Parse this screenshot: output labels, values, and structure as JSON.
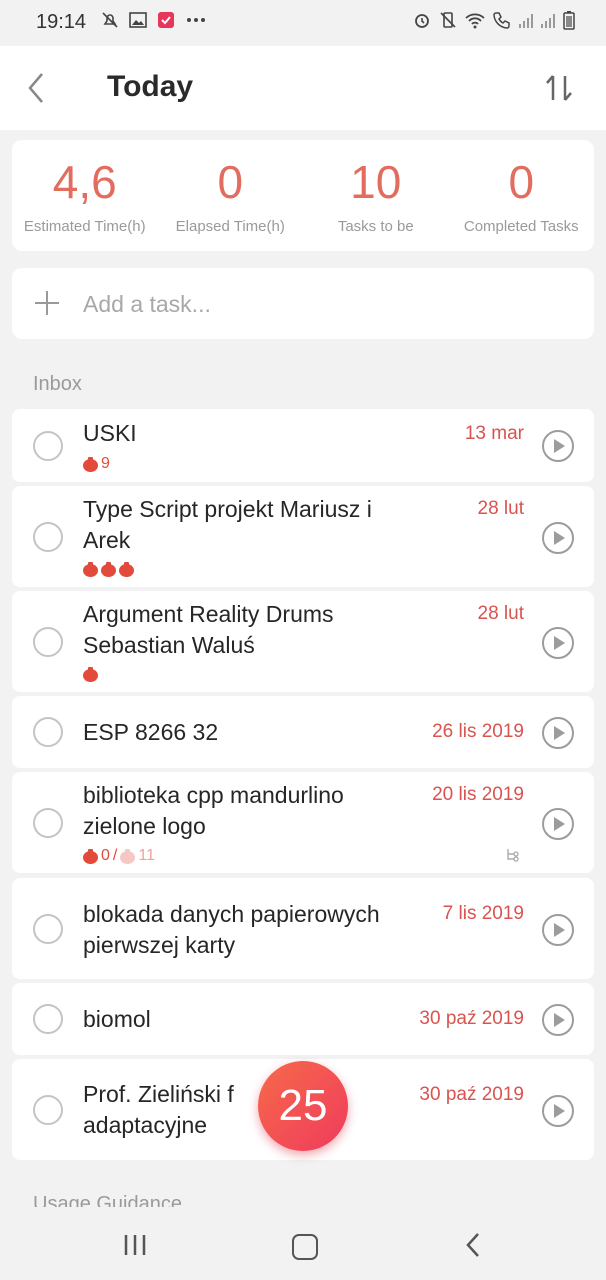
{
  "status_bar": {
    "time": "19:14",
    "left_icons": [
      "mute-notification-icon",
      "gallery-icon",
      "app-notification-icon",
      "more-dots-icon"
    ],
    "right_icons": [
      "alarm-icon",
      "vibrate-off-icon",
      "wifi-icon",
      "wifi-call-icon",
      "signal-icon",
      "signal-icon",
      "battery-icon"
    ]
  },
  "header": {
    "title": "Today",
    "back_icon": "back-chevron-icon",
    "sort_icon": "sort-icon"
  },
  "stats": [
    {
      "value": "4,6",
      "label": "Estimated Time(h)"
    },
    {
      "value": "0",
      "label": "Elapsed Time(h)"
    },
    {
      "value": "10",
      "label": "Tasks to be Completed"
    },
    {
      "value": "0",
      "label": "Completed Tasks"
    }
  ],
  "add_task": {
    "placeholder": "Add a task..."
  },
  "section_inbox": "Inbox",
  "tasks": [
    {
      "name": "USKI",
      "date": "13 mar",
      "pomo_count": "9"
    },
    {
      "name": "Type Script projekt Mariusz i Arek",
      "date": "28 lut"
    },
    {
      "name": "Argument Reality Drums Sebastian Waluś",
      "date": "28 lut"
    },
    {
      "name": "ESP 8266 32",
      "date": "26 lis 2019"
    },
    {
      "name": "biblioteka cpp mandurlino zielone logo",
      "date": "20 lis 2019",
      "pomo_done": "0",
      "pomo_sep": "/",
      "pomo_total": "11"
    },
    {
      "name": "blokada danych papierowych pierwszej karty",
      "date": "7 lis 2019"
    },
    {
      "name": "biomol",
      "date": "30 paź 2019"
    },
    {
      "name": "Prof. Zieliński f... adaptacyjne",
      "name_line1": "Prof. Zieliński f",
      "name_line2": "adaptacyjne",
      "date": "30 paź 2019"
    }
  ],
  "section_usage": "Usage Guidance",
  "fab": {
    "label": "25"
  },
  "colors": {
    "accent": "#e26d5f",
    "date": "#d9534f",
    "tomato": "#e24b3b"
  }
}
